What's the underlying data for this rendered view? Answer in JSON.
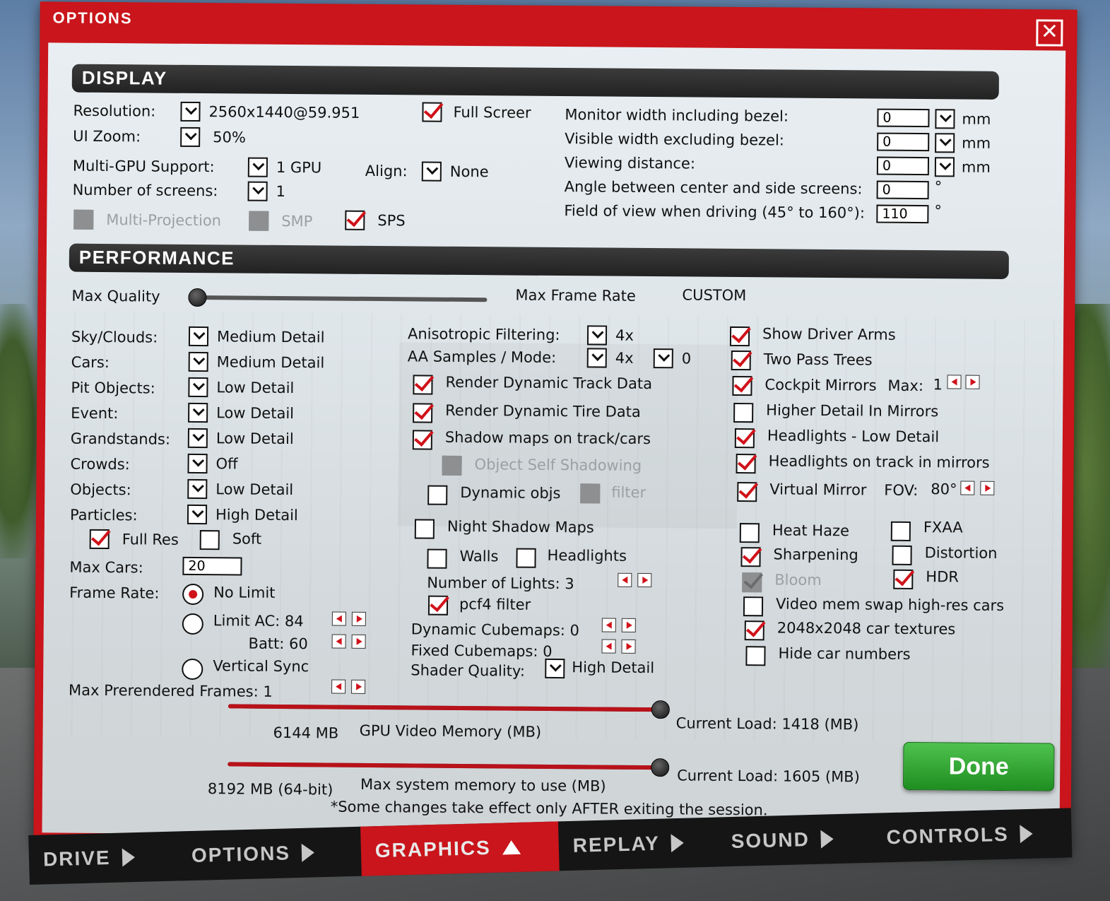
{
  "title": "OPTIONS",
  "display": {
    "header": "DISPLAY",
    "resolution_label": "Resolution:",
    "resolution": "2560x1440@59.951",
    "full_screen": "Full Screer",
    "ui_zoom_label": "UI Zoom:",
    "ui_zoom": "50%",
    "multi_gpu_label": "Multi-GPU Support:",
    "multi_gpu": "1 GPU",
    "align_label": "Align:",
    "align": "None",
    "screens_label": "Number of screens:",
    "screens": "1",
    "multi_projection": "Multi-Projection",
    "smp": "SMP",
    "sps": "SPS",
    "monitor_width_label": "Monitor width including bezel:",
    "monitor_width": "0",
    "visible_width_label": "Visible width excluding bezel:",
    "visible_width": "0",
    "viewing_distance_label": "Viewing distance:",
    "viewing_distance": "0",
    "angle_label": "Angle between center and side screens:",
    "angle": "0",
    "fov_label": "Field of view when driving (45° to 160°):",
    "fov": "110",
    "unit_mm": "mm",
    "unit_deg": "°"
  },
  "performance": {
    "header": "PERFORMANCE",
    "max_quality": "Max Quality",
    "max_frame_rate": "Max Frame Rate",
    "preset": "CUSTOM",
    "quality_level": 0.0,
    "left": [
      {
        "label": "Sky/Clouds:",
        "value": "Medium Detail"
      },
      {
        "label": "Cars:",
        "value": "Medium Detail"
      },
      {
        "label": "Pit Objects:",
        "value": "Low Detail"
      },
      {
        "label": "Event:",
        "value": "Low Detail"
      },
      {
        "label": "Grandstands:",
        "value": "Low Detail"
      },
      {
        "label": "Crowds:",
        "value": "Off"
      },
      {
        "label": "Objects:",
        "value": "Low Detail"
      },
      {
        "label": "Particles:",
        "value": "High Detail"
      }
    ],
    "full_res": "Full Res",
    "soft": "Soft",
    "max_cars_label": "Max Cars:",
    "max_cars": "20",
    "frame_rate_label": "Frame Rate:",
    "no_limit": "No Limit",
    "limit_ac": "Limit AC: 84",
    "batt": "Batt: 60",
    "vsync": "Vertical Sync",
    "prerendered": "Max Prerendered Frames: 1",
    "aniso_label": "Anisotropic Filtering:",
    "aniso": "4x",
    "aa_label": "AA Samples / Mode:",
    "aa_samples": "4x",
    "aa_mode": "0",
    "render_track": "Render Dynamic Track Data",
    "render_tire": "Render Dynamic Tire Data",
    "shadow_maps": "Shadow maps on track/cars",
    "self_shadowing": "Object Self Shadowing",
    "dynamic_objs": "Dynamic objs",
    "filter": "filter",
    "night_shadow": "Night Shadow Maps",
    "walls": "Walls",
    "headlights": "Headlights",
    "num_lights": "Number of Lights: 3",
    "pcf4": "pcf4 filter",
    "dyn_cubemaps": "Dynamic Cubemaps: 0",
    "fixed_cubemaps": "Fixed Cubemaps: 0",
    "shader_label": "Shader Quality:",
    "shader": "High Detail",
    "show_arms": "Show Driver Arms",
    "two_pass": "Two Pass Trees",
    "cockpit_mirrors": "Cockpit Mirrors",
    "mirrors_max": "Max:",
    "mirrors_max_val": "1",
    "higher_detail": "Higher Detail In Mirrors",
    "headlights_low": "Headlights - Low Detail",
    "headlights_track": "Headlights on track in mirrors",
    "virtual_mirror": "Virtual Mirror",
    "vm_fov": "FOV:",
    "vm_fov_val": "80°",
    "heat_haze": "Heat Haze",
    "fxaa": "FXAA",
    "sharpening": "Sharpening",
    "distortion": "Distortion",
    "bloom": "Bloom",
    "hdr": "HDR",
    "video_swap": "Video mem swap high-res cars",
    "textures_2048": "2048x2048 car textures",
    "hide_numbers": "Hide car numbers",
    "gpu_mem_value": "6144 MB",
    "gpu_mem_label": "GPU Video Memory (MB)",
    "gpu_load": "Current Load: 1418 (MB)",
    "gpu_mem_level": 1.0,
    "sys_mem_value": "8192 MB (64-bit)",
    "sys_mem_label": "Max system memory to use (MB)",
    "sys_load": "Current Load: 1605 (MB)",
    "sys_mem_level": 1.0,
    "note": "*Some changes take effect only AFTER exiting the session.",
    "done": "Done"
  },
  "tabs": [
    "DRIVE",
    "OPTIONS",
    "GRAPHICS",
    "REPLAY",
    "SOUND",
    "CONTROLS"
  ],
  "active_tab": "GRAPHICS",
  "colors": {
    "accent": "#c9151b",
    "done": "#2e9e2f",
    "panel": "#e2e8ec"
  }
}
